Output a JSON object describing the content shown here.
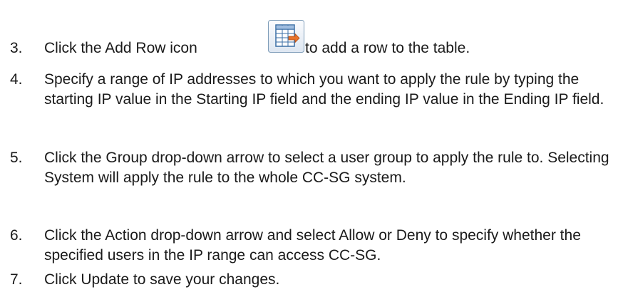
{
  "steps": [
    {
      "number": "3.",
      "before_icon": "Click the Add Row icon",
      "icon": "add-row-icon",
      "after_icon": "to add a row to the table."
    },
    {
      "number": "4.",
      "text": "Specify a range of IP addresses to which you want to apply the rule by typing the starting IP value in the Starting IP field and the ending IP value in the Ending IP field."
    },
    {
      "number": "5.",
      "text": "Click the Group drop-down arrow to select a user group to apply the rule to. Selecting System will apply the rule to the whole CC-SG system."
    },
    {
      "number": "6.",
      "text": "Click the Action drop-down arrow and select Allow or Deny to specify whether the specified users in the IP range can access CC-SG."
    },
    {
      "number": "7.",
      "text": "Click Update to save your changes."
    }
  ],
  "colors": {
    "text": "#1a1a1a",
    "icon_border": "#7f9db9",
    "icon_grid": "#3a6ea5",
    "icon_arrow": "#e8732a"
  }
}
